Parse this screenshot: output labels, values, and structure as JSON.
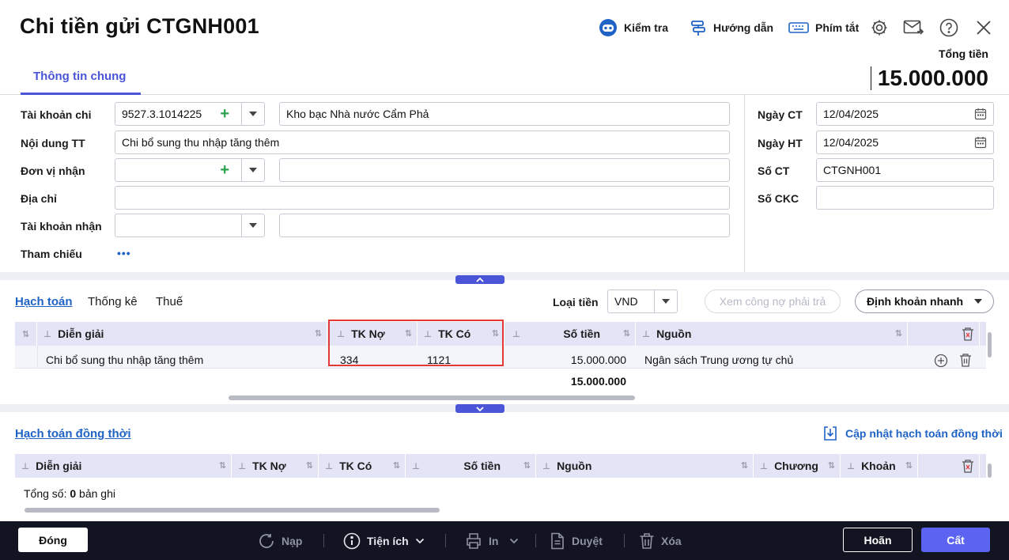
{
  "header": {
    "title": "Chi tiền gửi CTGNH001",
    "toolbar": {
      "check_label": "Kiểm tra",
      "guide_label": "Hướng dẫn",
      "shortcut_label": "Phím tắt"
    },
    "tab_general": "Thông tin chung",
    "total_label": "Tổng tiền",
    "total_value": "15.000.000"
  },
  "form": {
    "account_label": "Tài khoản chi",
    "account_value": "9527.3.1014225",
    "account_name": "Kho bạc Nhà nước Cẩm Phả",
    "content_label": "Nội dung TT",
    "content_value": "Chi bổ sung thu nhập tăng thêm",
    "receiver_label": "Đơn vị nhận",
    "receiver_value": "",
    "receiver_name": "",
    "address_label": "Địa chỉ",
    "address_value": "",
    "recv_account_label": "Tài khoản nhận",
    "recv_account_value": "",
    "recv_account_name": "",
    "reference_label": "Tham chiếu",
    "reference_more": "•••",
    "date_ct_label": "Ngày CT",
    "date_ct_value": "12/04/2025",
    "date_ht_label": "Ngày HT",
    "date_ht_value": "12/04/2025",
    "so_ct_label": "Số CT",
    "so_ct_value": "CTGNH001",
    "so_ckc_label": "Số CKC",
    "so_ckc_value": ""
  },
  "accounting": {
    "tabs": [
      "Hạch toán",
      "Thống kê",
      "Thuế"
    ],
    "currency_label": "Loại tiền",
    "currency_value": "VND",
    "debt_button": "Xem công nợ phải trả",
    "quick_button": "Định khoản nhanh",
    "columns": [
      "Diễn giải",
      "TK Nợ",
      "TK Có",
      "Số tiền",
      "Nguồn"
    ],
    "rows": [
      {
        "desc": "Chi bổ sung thu nhập tăng thêm",
        "debit": "334",
        "credit": "1121",
        "amount": "15.000.000",
        "source": "Ngân sách Trung ương tự chủ"
      }
    ],
    "total": "15.000.000"
  },
  "concurrent": {
    "title": "Hạch toán đồng thời",
    "update_label": "Cập nhật hạch toán đồng thời",
    "columns": [
      "Diễn giải",
      "TK Nợ",
      "TK Có",
      "Số tiền",
      "Nguồn",
      "Chương",
      "Khoản"
    ],
    "count_prefix": "Tổng số: ",
    "count_value": "0",
    "count_suffix": " bản ghi"
  },
  "footer": {
    "close": "Đóng",
    "reload": "Nạp",
    "utilities": "Tiện ích",
    "print": "In",
    "approve": "Duyệt",
    "delete": "Xóa",
    "cancel": "Hoãn",
    "save": "Cất"
  },
  "colors": {
    "accent": "#4a55d8",
    "link": "#1f63c6",
    "highlight": "#e53935",
    "footer_bg": "#121421",
    "grid_header": "#e3e5f7"
  }
}
